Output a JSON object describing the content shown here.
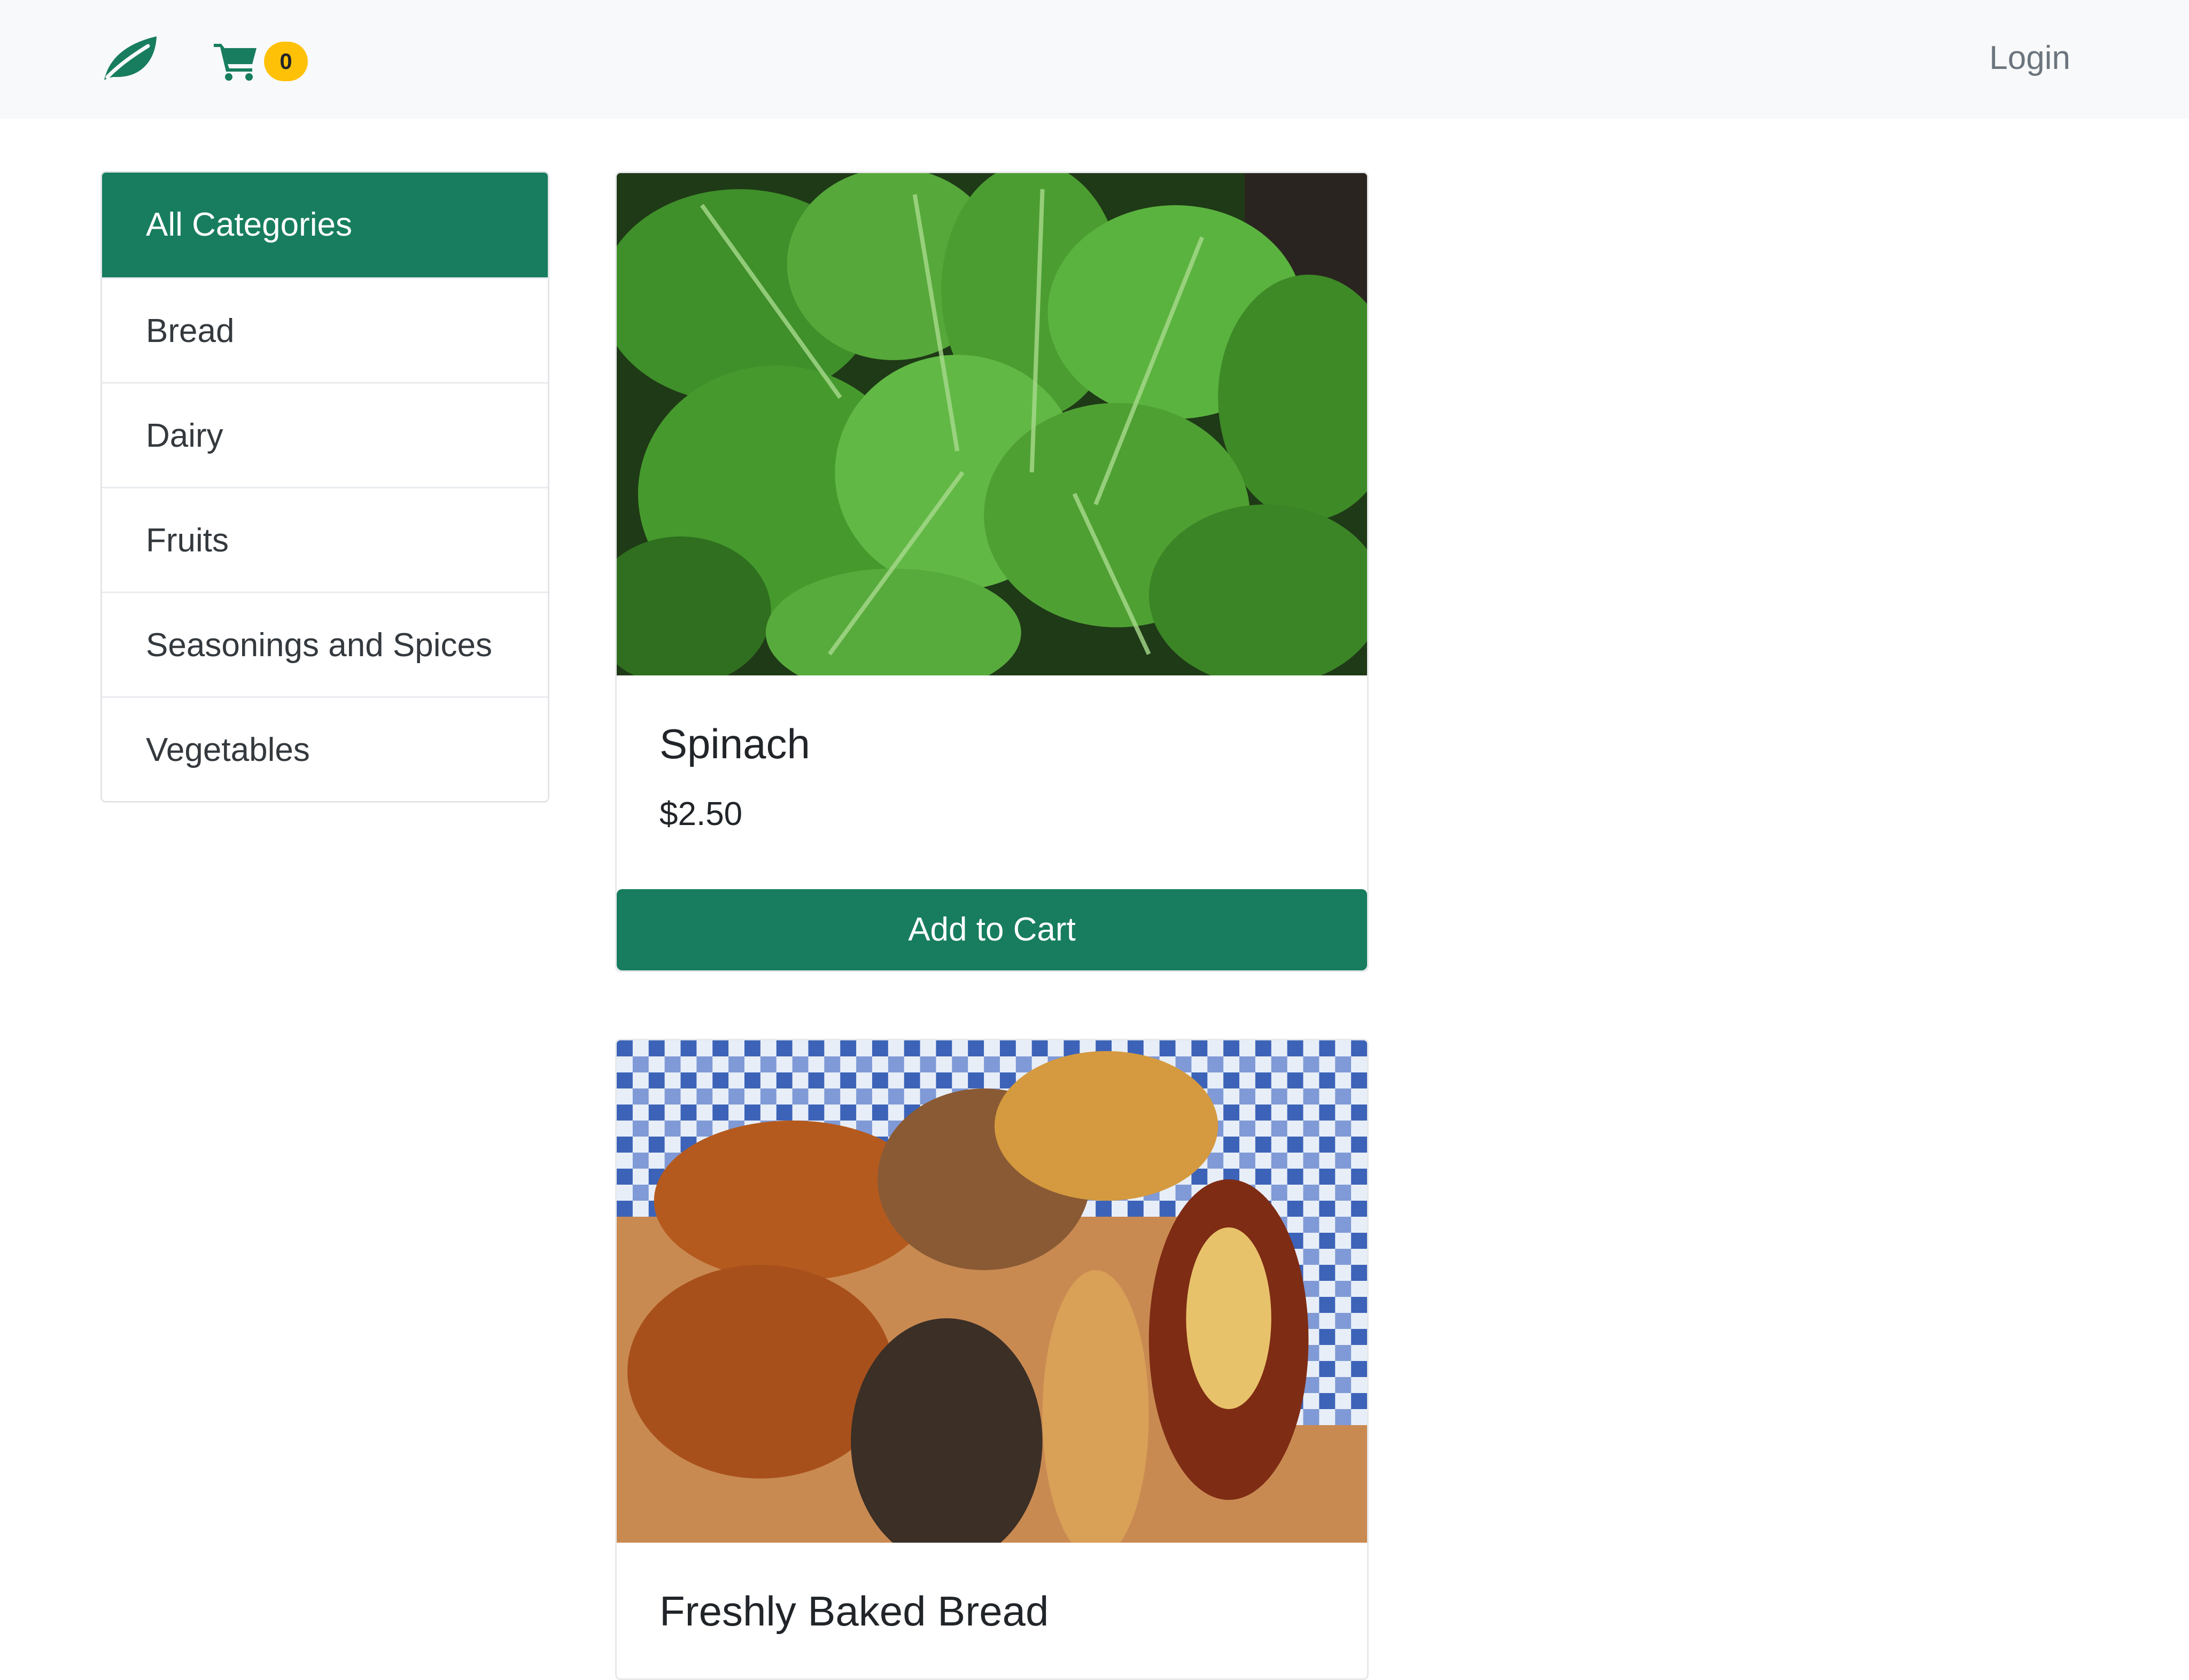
{
  "navbar": {
    "brand_icon": "leaf-icon",
    "cart_icon": "shopping-cart-icon",
    "cart_count": "0",
    "login_label": "Login"
  },
  "categories": {
    "items": [
      {
        "label": "All Categories",
        "active": true
      },
      {
        "label": "Bread",
        "active": false
      },
      {
        "label": "Dairy",
        "active": false
      },
      {
        "label": "Fruits",
        "active": false
      },
      {
        "label": "Seasonings and Spices",
        "active": false
      },
      {
        "label": "Vegetables",
        "active": false
      }
    ]
  },
  "products": [
    {
      "name": "Spinach",
      "price": "$2.50",
      "button_label": "Add to Cart",
      "image": "spinach-leaves-photo"
    },
    {
      "name": "Freshly Baked Bread",
      "image": "bread-rolls-photo"
    }
  ],
  "colors": {
    "primary": "#177d5e",
    "badge": "#ffc107",
    "navbar_bg": "#f8f9fa",
    "muted_text": "#6c757d"
  }
}
